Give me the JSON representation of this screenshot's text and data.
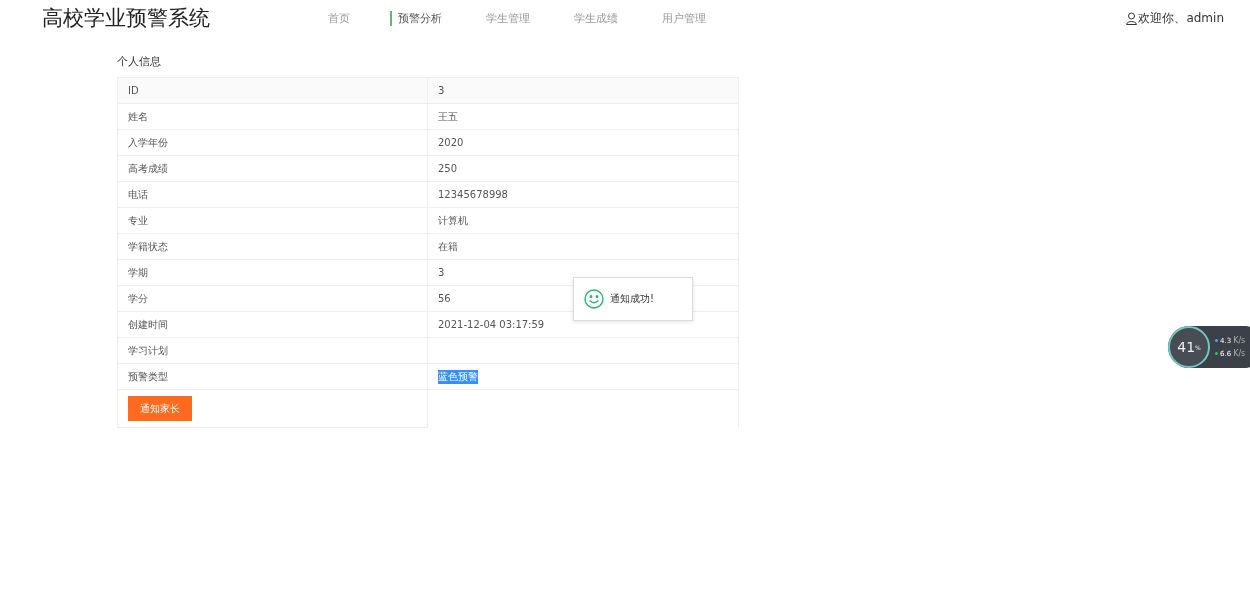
{
  "header": {
    "title": "高校学业预警系统",
    "nav": [
      {
        "label": "首页",
        "selected": false
      },
      {
        "label": "预警分析",
        "selected": true
      },
      {
        "label": "学生管理",
        "selected": false
      },
      {
        "label": "学生成绩",
        "selected": false
      },
      {
        "label": "用户管理",
        "selected": false
      }
    ],
    "user": "欢迎你、admin"
  },
  "section_title": "个人信息",
  "rows": [
    {
      "label": "ID",
      "value": "3",
      "highlighted": false
    },
    {
      "label": "姓名",
      "value": "王五",
      "highlighted": false
    },
    {
      "label": "入学年份",
      "value": "2020",
      "highlighted": false
    },
    {
      "label": "高考成绩",
      "value": "250",
      "highlighted": false
    },
    {
      "label": "电话",
      "value": "12345678998",
      "highlighted": false
    },
    {
      "label": "专业",
      "value": "计算机",
      "highlighted": false
    },
    {
      "label": "学籍状态",
      "value": "在籍",
      "highlighted": false
    },
    {
      "label": "学期",
      "value": "3",
      "highlighted": false
    },
    {
      "label": "学分",
      "value": "56",
      "highlighted": false
    },
    {
      "label": "创建时间",
      "value": "2021-12-04 03:17:59",
      "highlighted": false
    },
    {
      "label": "学习计划"
    },
    {
      "label": "预警类型",
      "value": "蓝色预警",
      "highlighted": true
    }
  ],
  "action_button": "通知家长",
  "toast": {
    "message": "通知成功!"
  },
  "speed_widget": {
    "percent": "41",
    "unit": "%",
    "up": "4.3",
    "up_unit": "K/s",
    "down": "6.6",
    "down_unit": "K/s"
  }
}
